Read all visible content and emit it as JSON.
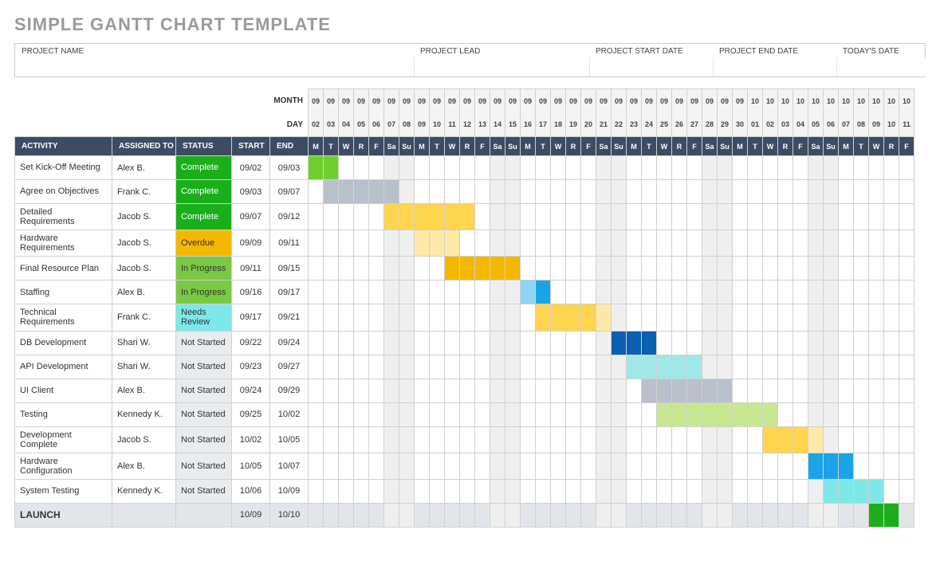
{
  "title": "SIMPLE GANTT CHART TEMPLATE",
  "meta": {
    "project_name_label": "PROJECT NAME",
    "project_lead_label": "PROJECT LEAD",
    "project_start_label": "PROJECT START DATE",
    "project_end_label": "PROJECT END DATE",
    "today_label": "TODAY'S DATE",
    "project_name": "",
    "project_lead": "",
    "project_start": "",
    "project_end": "",
    "today": ""
  },
  "labels": {
    "month": "MONTH",
    "day": "DAY",
    "activity": "ACTIVITY",
    "assigned": "ASSIGNED TO",
    "status": "STATUS",
    "start": "START",
    "end": "END"
  },
  "status_styles": {
    "Complete": {
      "class": "status-complete"
    },
    "Overdue": {
      "class": "status-overdue"
    },
    "In Progress": {
      "class": "status-inprogress"
    },
    "Needs Review": {
      "class": "status-review"
    },
    "Not Started": {
      "class": "status-notstarted"
    }
  },
  "bar_colors": {
    "green": "#6fcf2f",
    "gray": "#b8c0cc",
    "yellow": "#ffd54d",
    "yellow_faded": "#ffe9a8",
    "orange": "#f5b800",
    "blue": "#1aa3e8",
    "blue_faded": "#8fd4f2",
    "darkblue": "#0a5fb0",
    "lightblue": "#a0e8e8",
    "lightgreen": "#c8e88f",
    "teal": "#7ee8e8",
    "green_solid": "#1aaf1a"
  },
  "chart_data": {
    "type": "gantt",
    "calendar": {
      "start": "09/02",
      "end": "10/11",
      "days": [
        {
          "month": "09",
          "day": "02",
          "dow": "M",
          "weekend": false
        },
        {
          "month": "09",
          "day": "03",
          "dow": "T",
          "weekend": false
        },
        {
          "month": "09",
          "day": "04",
          "dow": "W",
          "weekend": false
        },
        {
          "month": "09",
          "day": "05",
          "dow": "R",
          "weekend": false
        },
        {
          "month": "09",
          "day": "06",
          "dow": "F",
          "weekend": false
        },
        {
          "month": "09",
          "day": "07",
          "dow": "Sa",
          "weekend": true
        },
        {
          "month": "09",
          "day": "08",
          "dow": "Su",
          "weekend": true
        },
        {
          "month": "09",
          "day": "09",
          "dow": "M",
          "weekend": false
        },
        {
          "month": "09",
          "day": "10",
          "dow": "T",
          "weekend": false
        },
        {
          "month": "09",
          "day": "11",
          "dow": "W",
          "weekend": false
        },
        {
          "month": "09",
          "day": "12",
          "dow": "R",
          "weekend": false
        },
        {
          "month": "09",
          "day": "13",
          "dow": "F",
          "weekend": false
        },
        {
          "month": "09",
          "day": "14",
          "dow": "Sa",
          "weekend": true
        },
        {
          "month": "09",
          "day": "15",
          "dow": "Su",
          "weekend": true
        },
        {
          "month": "09",
          "day": "16",
          "dow": "M",
          "weekend": false
        },
        {
          "month": "09",
          "day": "17",
          "dow": "T",
          "weekend": false
        },
        {
          "month": "09",
          "day": "18",
          "dow": "W",
          "weekend": false
        },
        {
          "month": "09",
          "day": "19",
          "dow": "R",
          "weekend": false
        },
        {
          "month": "09",
          "day": "20",
          "dow": "F",
          "weekend": false
        },
        {
          "month": "09",
          "day": "21",
          "dow": "Sa",
          "weekend": true
        },
        {
          "month": "09",
          "day": "22",
          "dow": "Su",
          "weekend": true
        },
        {
          "month": "09",
          "day": "23",
          "dow": "M",
          "weekend": false
        },
        {
          "month": "09",
          "day": "24",
          "dow": "T",
          "weekend": false
        },
        {
          "month": "09",
          "day": "25",
          "dow": "W",
          "weekend": false
        },
        {
          "month": "09",
          "day": "26",
          "dow": "R",
          "weekend": false
        },
        {
          "month": "09",
          "day": "27",
          "dow": "F",
          "weekend": false
        },
        {
          "month": "09",
          "day": "28",
          "dow": "Sa",
          "weekend": true
        },
        {
          "month": "09",
          "day": "29",
          "dow": "Su",
          "weekend": true
        },
        {
          "month": "09",
          "day": "30",
          "dow": "M",
          "weekend": false
        },
        {
          "month": "10",
          "day": "01",
          "dow": "T",
          "weekend": false
        },
        {
          "month": "10",
          "day": "02",
          "dow": "W",
          "weekend": false
        },
        {
          "month": "10",
          "day": "03",
          "dow": "R",
          "weekend": false
        },
        {
          "month": "10",
          "day": "04",
          "dow": "F",
          "weekend": false
        },
        {
          "month": "10",
          "day": "05",
          "dow": "Sa",
          "weekend": true
        },
        {
          "month": "10",
          "day": "06",
          "dow": "Su",
          "weekend": true
        },
        {
          "month": "10",
          "day": "07",
          "dow": "M",
          "weekend": false
        },
        {
          "month": "10",
          "day": "08",
          "dow": "T",
          "weekend": false
        },
        {
          "month": "10",
          "day": "09",
          "dow": "W",
          "weekend": false
        },
        {
          "month": "10",
          "day": "10",
          "dow": "R",
          "weekend": false
        },
        {
          "month": "10",
          "day": "11",
          "dow": "F",
          "weekend": false
        }
      ]
    },
    "tasks": [
      {
        "activity": "Set Kick-Off Meeting",
        "assigned": "Alex B.",
        "status": "Complete",
        "start": "09/02",
        "end": "09/03",
        "bars": [
          {
            "from": 0,
            "to": 1,
            "color": "green"
          }
        ]
      },
      {
        "activity": "Agree on Objectives",
        "assigned": "Frank C.",
        "status": "Complete",
        "start": "09/03",
        "end": "09/07",
        "bars": [
          {
            "from": 1,
            "to": 5,
            "color": "gray"
          }
        ]
      },
      {
        "activity": "Detailed Requirements",
        "assigned": "Jacob S.",
        "status": "Complete",
        "start": "09/07",
        "end": "09/12",
        "bars": [
          {
            "from": 5,
            "to": 10,
            "color": "yellow"
          }
        ]
      },
      {
        "activity": "Hardware Requirements",
        "assigned": "Jacob S.",
        "status": "Overdue",
        "start": "09/09",
        "end": "09/11",
        "bars": [
          {
            "from": 7,
            "to": 9,
            "color": "yellow_faded"
          }
        ]
      },
      {
        "activity": "Final Resource Plan",
        "assigned": "Jacob S.",
        "status": "In Progress",
        "start": "09/11",
        "end": "09/15",
        "bars": [
          {
            "from": 9,
            "to": 13,
            "color": "orange"
          }
        ]
      },
      {
        "activity": "Staffing",
        "assigned": "Alex B.",
        "status": "In Progress",
        "start": "09/16",
        "end": "09/17",
        "bars": [
          {
            "from": 14,
            "to": 14,
            "color": "blue_faded"
          },
          {
            "from": 15,
            "to": 15,
            "color": "blue"
          }
        ]
      },
      {
        "activity": "Technical Requirements",
        "assigned": "Frank C.",
        "status": "Needs Review",
        "start": "09/17",
        "end": "09/21",
        "bars": [
          {
            "from": 15,
            "to": 18,
            "color": "yellow"
          },
          {
            "from": 19,
            "to": 19,
            "color": "yellow_faded"
          }
        ]
      },
      {
        "activity": "DB Development",
        "assigned": "Shari W.",
        "status": "Not Started",
        "start": "09/22",
        "end": "09/24",
        "bars": [
          {
            "from": 20,
            "to": 20,
            "color": "darkblue"
          },
          {
            "from": 21,
            "to": 22,
            "color": "darkblue"
          }
        ]
      },
      {
        "activity": "API Development",
        "assigned": "Shari W.",
        "status": "Not Started",
        "start": "09/23",
        "end": "09/27",
        "bars": [
          {
            "from": 21,
            "to": 25,
            "color": "lightblue"
          }
        ]
      },
      {
        "activity": "UI Client",
        "assigned": "Alex B.",
        "status": "Not Started",
        "start": "09/24",
        "end": "09/29",
        "bars": [
          {
            "from": 22,
            "to": 27,
            "color": "gray"
          }
        ]
      },
      {
        "activity": "Testing",
        "assigned": "Kennedy K.",
        "status": "Not Started",
        "start": "09/25",
        "end": "10/02",
        "bars": [
          {
            "from": 23,
            "to": 30,
            "color": "lightgreen"
          }
        ]
      },
      {
        "activity": "Development Complete",
        "assigned": "Jacob S.",
        "status": "Not Started",
        "start": "10/02",
        "end": "10/05",
        "bars": [
          {
            "from": 30,
            "to": 32,
            "color": "yellow"
          },
          {
            "from": 33,
            "to": 33,
            "color": "yellow_faded"
          }
        ]
      },
      {
        "activity": "Hardware Configuration",
        "assigned": "Alex B.",
        "status": "Not Started",
        "start": "10/05",
        "end": "10/07",
        "bars": [
          {
            "from": 33,
            "to": 35,
            "color": "blue"
          }
        ]
      },
      {
        "activity": "System Testing",
        "assigned": "Kennedy K.",
        "status": "Not Started",
        "start": "10/06",
        "end": "10/09",
        "bars": [
          {
            "from": 34,
            "to": 37,
            "color": "teal"
          }
        ]
      },
      {
        "activity": "LAUNCH",
        "assigned": "",
        "status": "",
        "start": "10/09",
        "end": "10/10",
        "launch": true,
        "bars": [
          {
            "from": 37,
            "to": 38,
            "color": "green_solid"
          }
        ]
      }
    ]
  }
}
